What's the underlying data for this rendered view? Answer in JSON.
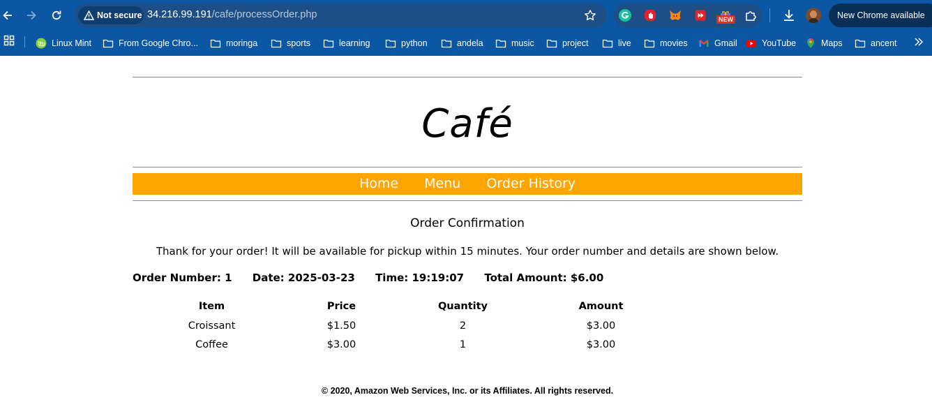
{
  "browser": {
    "security_label": "Not secure",
    "url_host": "34.216.99.191",
    "url_path": "/cafe/processOrder.php",
    "new_badge": "NEW",
    "update_label": "New Chrome available",
    "extensions": [
      "grammarly-icon",
      "adblock-icon",
      "metamask-icon",
      "video-extension-icon",
      "gift-extension-icon",
      "extensions-puzzle-icon"
    ],
    "colors": {
      "toolbar": "#0b57a3",
      "omnibox": "#1d4f86"
    }
  },
  "bookmarks": [
    {
      "label": "Linux Mint",
      "icon": "linux-mint-icon"
    },
    {
      "label": "From Google Chro...",
      "icon": "folder-icon"
    },
    {
      "label": "moringa",
      "icon": "folder-icon"
    },
    {
      "label": "sports",
      "icon": "folder-icon"
    },
    {
      "label": "learning",
      "icon": "folder-icon"
    },
    {
      "label": "python",
      "icon": "folder-icon"
    },
    {
      "label": "andela",
      "icon": "folder-icon"
    },
    {
      "label": "music",
      "icon": "folder-icon"
    },
    {
      "label": "project",
      "icon": "folder-icon"
    },
    {
      "label": "live",
      "icon": "folder-icon"
    },
    {
      "label": "movies",
      "icon": "folder-icon"
    },
    {
      "label": "Gmail",
      "icon": "gmail-icon"
    },
    {
      "label": "YouTube",
      "icon": "youtube-icon"
    },
    {
      "label": "Maps",
      "icon": "maps-icon"
    },
    {
      "label": "ancent",
      "icon": "folder-icon"
    }
  ],
  "site": {
    "title": "Café",
    "nav": [
      "Home",
      "Menu",
      "Order History"
    ],
    "accent_color": "#ffa500"
  },
  "order": {
    "heading": "Order Confirmation",
    "thanks": "Thank for your order! It will be available for pickup within 15 minutes. Your order number and details are shown below.",
    "number": "Order Number: 1",
    "date": "Date: 2025-03-23",
    "time": "Time: 19:19:07",
    "total": "Total Amount: $6.00",
    "columns": [
      "Item",
      "Price",
      "Quantity",
      "Amount"
    ],
    "rows": [
      [
        "Croissant",
        "$1.50",
        "2",
        "$3.00"
      ],
      [
        "Coffee",
        "$3.00",
        "1",
        "$3.00"
      ]
    ]
  },
  "footer": "© 2020, Amazon Web Services, Inc. or its Affiliates. All rights reserved."
}
